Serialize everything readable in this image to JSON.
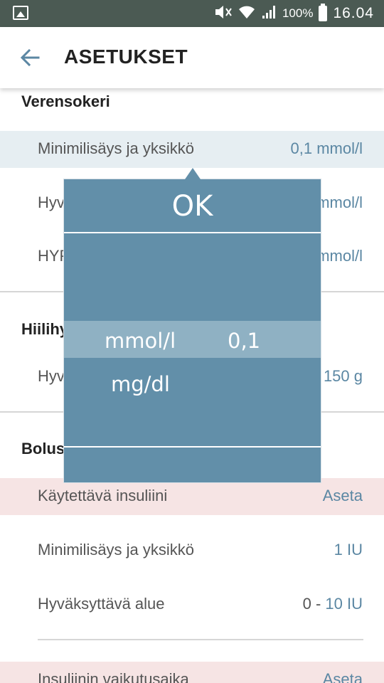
{
  "statusbar": {
    "battery": "100%",
    "time": "16.04",
    "icons": [
      "image-icon",
      "mute-icon",
      "wifi-icon",
      "signal-icon",
      "battery-icon"
    ]
  },
  "appbar": {
    "title": "ASETUKSET",
    "back_icon": "back-arrow-icon"
  },
  "sections": {
    "blood_sugar": {
      "title": "Verensokeri",
      "rows": [
        {
          "label": "Minimilisäys ja yksikkö",
          "value": "0,1 mmol/l"
        },
        {
          "label": "Hyv",
          "value": "mmol/l"
        },
        {
          "label": "HYP",
          "value": "mmol/l"
        }
      ]
    },
    "carbs": {
      "title": "Hiilihy",
      "rows": [
        {
          "label": "Hyv",
          "value": "150 g"
        }
      ]
    },
    "bolus": {
      "title": "Bolusi",
      "rows": [
        {
          "label": "Käytettävä insuliini",
          "value": "Aseta"
        },
        {
          "label": "Minimilisäys ja yksikkö",
          "value": "1 IU"
        },
        {
          "label": "Hyväksyttävä alue",
          "value_prefix": "0 - ",
          "value": "10 IU"
        },
        {
          "label": "Insuliinin vaikutusaika",
          "value": "Aseta"
        }
      ]
    }
  },
  "dialog": {
    "ok_label": "OK",
    "unit_selected": "mmol/l",
    "increment_selected": "0,1",
    "unit_option": "mg/dl"
  },
  "colors": {
    "accent": "#5b87a3",
    "dialog": "#628fa9",
    "dialog_selection": "#8fb1c3",
    "highlight_blue": "#e6eef2",
    "highlight_red": "#f6e4e4",
    "statusbar": "#4b5a53"
  }
}
